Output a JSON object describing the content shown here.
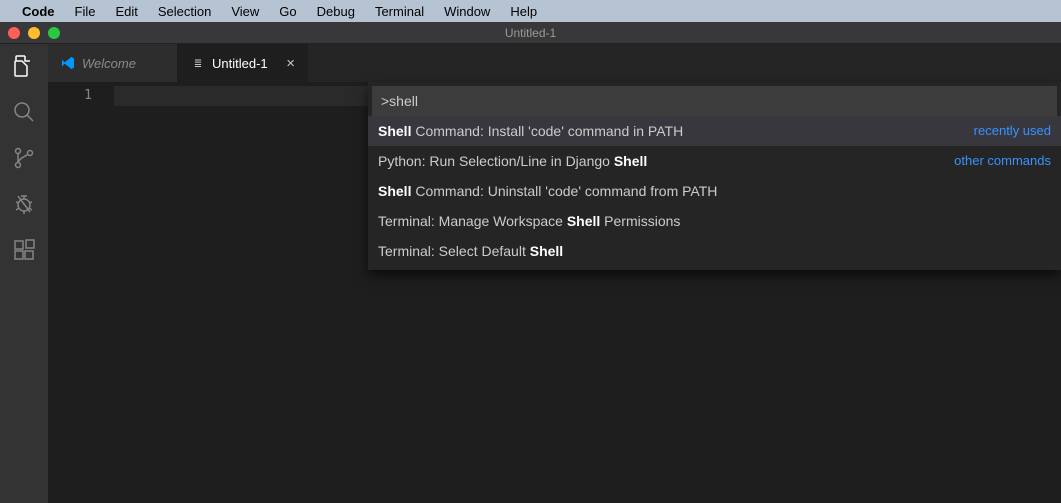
{
  "menubar": {
    "app": "Code",
    "items": [
      "File",
      "Edit",
      "Selection",
      "View",
      "Go",
      "Debug",
      "Terminal",
      "Window",
      "Help"
    ]
  },
  "titlebar": {
    "title": "Untitled-1"
  },
  "tabs": {
    "welcome": {
      "label": "Welcome"
    },
    "untitled": {
      "label": "Untitled-1"
    }
  },
  "editor": {
    "line1": "1"
  },
  "quickopen": {
    "input": ">shell",
    "hints": {
      "recent": "recently used",
      "other": "other commands"
    },
    "items": [
      {
        "pre": "",
        "hl": "Shell",
        "post": " Command: Install 'code' command in PATH"
      },
      {
        "pre": "Python: Run Selection/Line in Django ",
        "hl": "Shell",
        "post": ""
      },
      {
        "pre": "",
        "hl": "Shell",
        "post": " Command: Uninstall 'code' command from PATH"
      },
      {
        "pre": "Terminal: Manage Workspace ",
        "hl": "Shell",
        "post": " Permissions"
      },
      {
        "pre": "Terminal: Select Default ",
        "hl": "Shell",
        "post": ""
      }
    ]
  }
}
